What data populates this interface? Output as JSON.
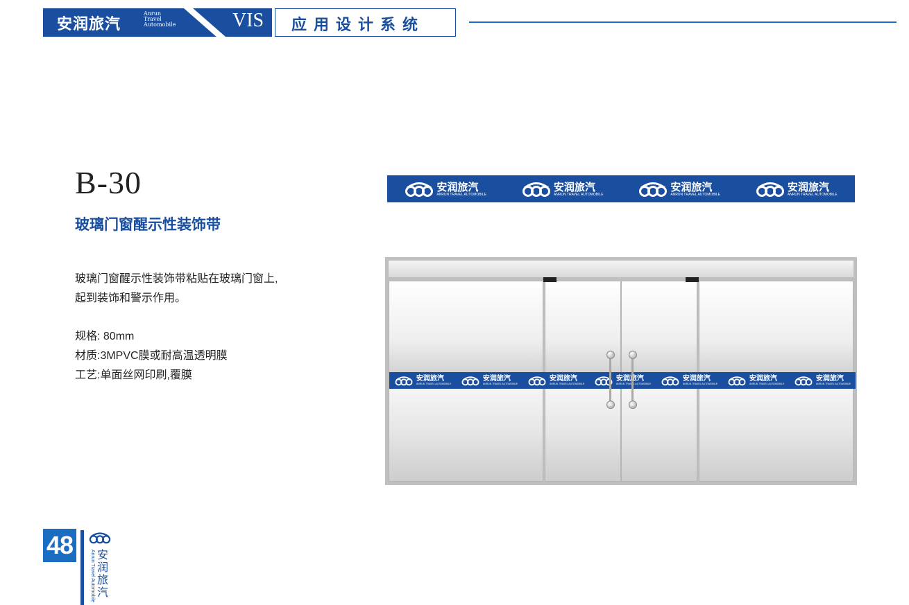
{
  "header": {
    "brand_cn": "安润旅汽",
    "brand_en_1": "Anrun",
    "brand_en_2": "Travel",
    "brand_en_3": "Automobile",
    "vis": "VIS",
    "section": "应用设计系统"
  },
  "item": {
    "code": "B-30",
    "title": "玻璃门窗醒示性装饰带",
    "description_line1": "玻璃门窗醒示性装饰带粘贴在玻璃门窗上,",
    "description_line2": "起到装饰和警示作用。",
    "spec_size": "规格: 80mm",
    "spec_material": "材质:3MPVC膜或耐高温透明膜",
    "spec_process": "工艺:单面丝网印刷,覆膜"
  },
  "band_logo": {
    "cn": "安润旅汽",
    "en": "ANRUN TRAVEL AUTOMOBILE"
  },
  "footer": {
    "page_number": "48",
    "brand_cn": "安润旅汽",
    "brand_en": "Anrun Travel Automobile"
  },
  "colors": {
    "brand_blue": "#1a4fa0",
    "accent_blue": "#1a6dc0"
  }
}
